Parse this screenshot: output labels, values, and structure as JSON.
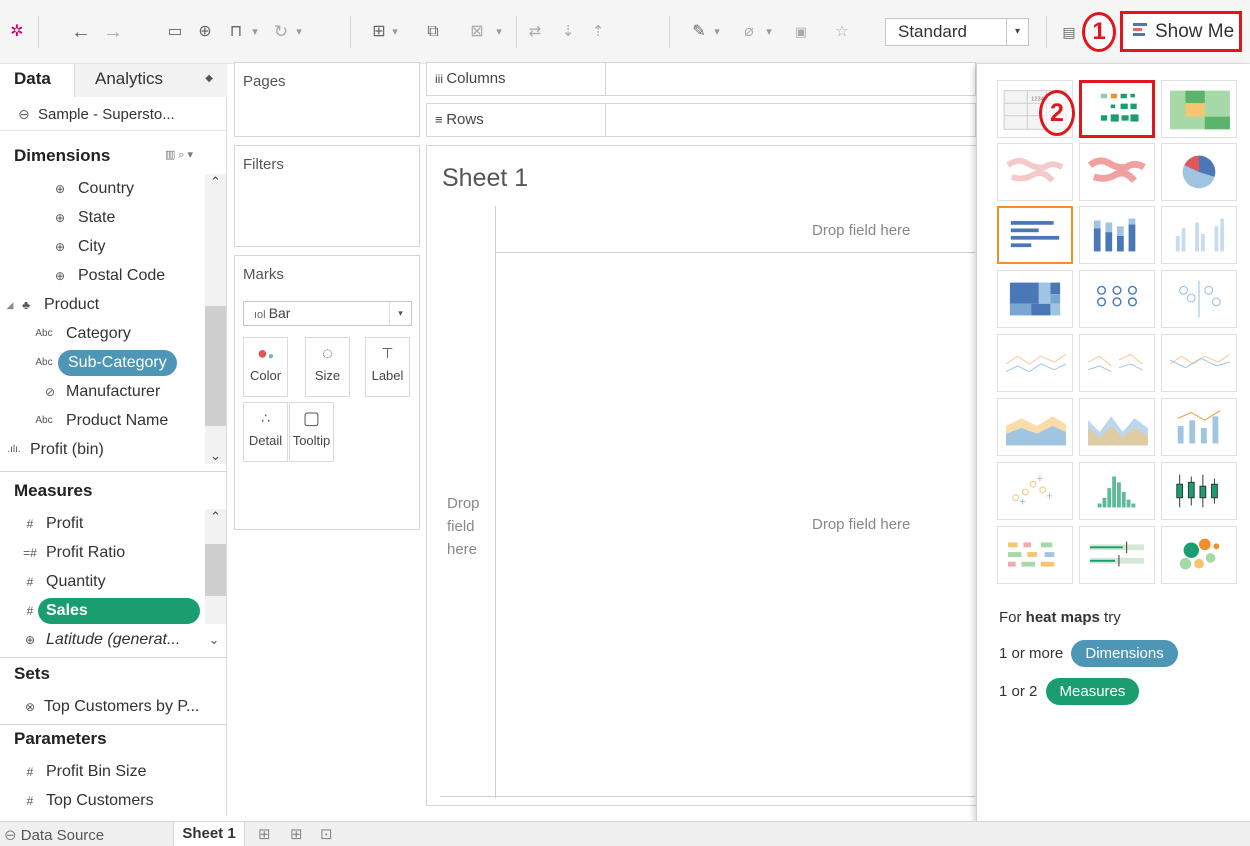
{
  "toolbar": {
    "fit_value": "Standard",
    "show_me_label": "Show Me",
    "callout_1": "1",
    "callout_2": "2",
    "icons": [
      "tableau-logo-icon",
      "back-icon",
      "forward-icon",
      "save-icon",
      "new-datasource-icon",
      "pause-icon",
      "refresh-icon",
      "new-worksheet-icon",
      "duplicate-icon",
      "clear-icon",
      "swap-icon",
      "sort-asc-icon",
      "sort-desc-icon",
      "highlight-icon",
      "group-icon",
      "label-icon",
      "pin-icon",
      "presentation-icon"
    ]
  },
  "data_pane": {
    "tab_data": "Data",
    "tab_analytics": "Analytics",
    "datasource": "Sample - Supersto...",
    "dimensions_header": "Dimensions",
    "dimensions": [
      {
        "label": "Country",
        "icon": "globe-icon"
      },
      {
        "label": "State",
        "icon": "globe-icon"
      },
      {
        "label": "City",
        "icon": "globe-icon"
      },
      {
        "label": "Postal Code",
        "icon": "globe-icon"
      },
      {
        "label": "Product",
        "icon": "hierarchy-icon"
      },
      {
        "label": "Category",
        "icon": "abc-icon"
      },
      {
        "label": "Sub-Category",
        "icon": "abc-icon"
      },
      {
        "label": "Manufacturer",
        "icon": "paperclip-icon"
      },
      {
        "label": "Product Name",
        "icon": "abc-icon"
      },
      {
        "label": "Profit (bin)",
        "icon": "bin-icon"
      }
    ],
    "measures_header": "Measures",
    "measures": [
      {
        "label": "Profit",
        "icon": "number-icon"
      },
      {
        "label": "Profit Ratio",
        "icon": "calc-number-icon"
      },
      {
        "label": "Quantity",
        "icon": "number-icon"
      },
      {
        "label": "Sales",
        "icon": "number-icon"
      },
      {
        "label": "Latitude (generat...",
        "icon": "globe-icon"
      }
    ],
    "sets_header": "Sets",
    "sets": [
      {
        "label": "Top Customers by P...",
        "icon": "set-icon"
      }
    ],
    "parameters_header": "Parameters",
    "parameters": [
      {
        "label": "Profit Bin Size",
        "icon": "number-icon"
      },
      {
        "label": "Top Customers",
        "icon": "number-icon"
      }
    ]
  },
  "cards": {
    "pages": "Pages",
    "filters": "Filters",
    "marks": "Marks",
    "mark_type": "Bar",
    "mark_buttons": [
      "Color",
      "Size",
      "Label",
      "Detail",
      "Tooltip"
    ]
  },
  "shelves": {
    "columns": "Columns",
    "rows": "Rows"
  },
  "view": {
    "sheet_title": "Sheet 1",
    "drop_top": "Drop field here",
    "drop_center": "Drop field here",
    "drop_left": "Drop\nfield\nhere"
  },
  "showme": {
    "hint_prefix": "For",
    "hint_type": "heat maps",
    "hint_suffix": "try",
    "row1_prefix": "1 or more",
    "row1_pill": "Dimensions",
    "row2_prefix": "1 or 2",
    "row2_pill": "Measures",
    "charts": [
      "text-table",
      "heat-map",
      "highlight-table",
      "symbol-map",
      "filled-map",
      "pie-chart",
      "horizontal-bars",
      "stacked-bars",
      "side-by-side-bars",
      "treemap",
      "circle-views",
      "side-by-side-circles",
      "line-continuous",
      "line-discrete",
      "dual-lines",
      "area-continuous",
      "area-discrete",
      "dual-combination",
      "scatter-plot",
      "histogram",
      "box-and-whisker",
      "gantt-chart",
      "bullet-graph",
      "packed-bubbles"
    ]
  },
  "bottom": {
    "data_source": "Data Source",
    "sheet_tab": "Sheet 1"
  },
  "colors": {
    "accent_orange": "#f28e2b",
    "dimension_blue": "#4e96b6",
    "measure_green": "#1b9e6f",
    "annotation_red": "#e0161c"
  }
}
